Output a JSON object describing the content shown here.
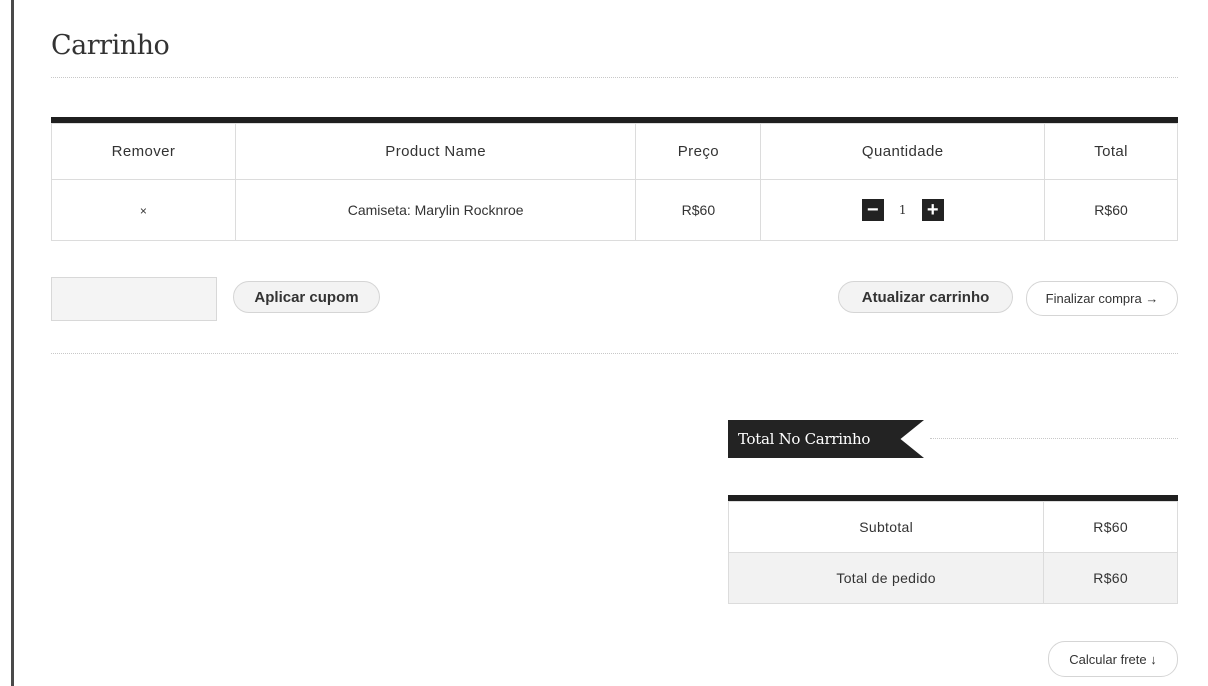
{
  "page": {
    "title": "Carrinho"
  },
  "cart": {
    "headers": [
      "Remover",
      "Product Name",
      "Preço",
      "Quantidade",
      "Total"
    ],
    "items": [
      {
        "remove": "×",
        "name": "Camiseta: Marylin Rocknroe",
        "price": "R$60",
        "quantity": "1",
        "total": "R$60"
      }
    ],
    "qty_minus": "−",
    "qty_plus": "+"
  },
  "actions": {
    "coupon_value": "",
    "apply_coupon": "Aplicar cupom",
    "update_cart": "Atualizar carrinho",
    "checkout": "Finalizar compra →"
  },
  "totals": {
    "heading": "Total No Carrinho",
    "rows": [
      {
        "label": "Subtotal",
        "value": "R$60"
      },
      {
        "label": "Total de pedido",
        "value": "R$60"
      }
    ],
    "shipping_button": "Calcular frete ↓"
  }
}
